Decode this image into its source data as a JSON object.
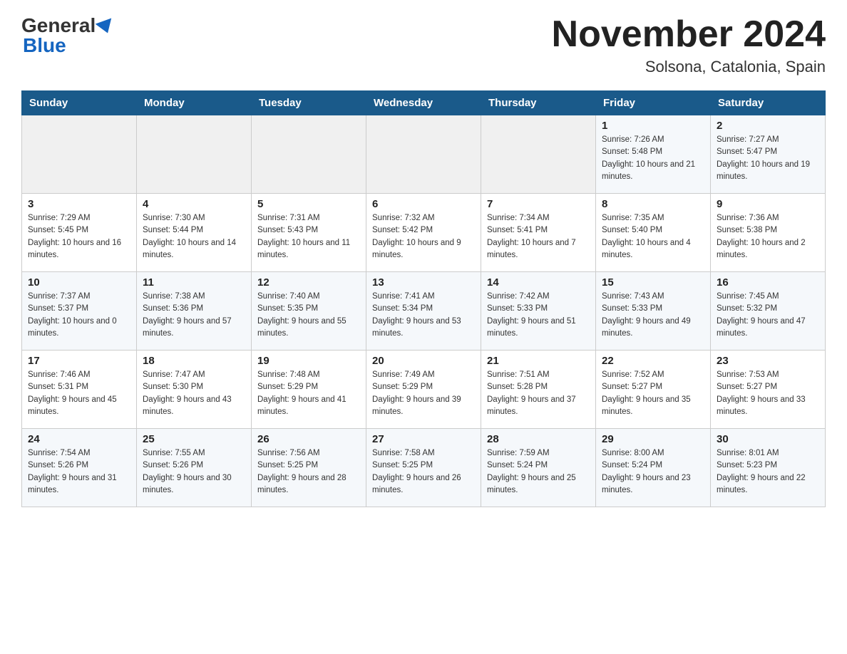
{
  "header": {
    "logo_general": "General",
    "logo_blue": "Blue",
    "title": "November 2024",
    "subtitle": "Solsona, Catalonia, Spain"
  },
  "calendar": {
    "weekdays": [
      "Sunday",
      "Monday",
      "Tuesday",
      "Wednesday",
      "Thursday",
      "Friday",
      "Saturday"
    ],
    "weeks": [
      [
        {
          "day": "",
          "info": ""
        },
        {
          "day": "",
          "info": ""
        },
        {
          "day": "",
          "info": ""
        },
        {
          "day": "",
          "info": ""
        },
        {
          "day": "",
          "info": ""
        },
        {
          "day": "1",
          "info": "Sunrise: 7:26 AM\nSunset: 5:48 PM\nDaylight: 10 hours and 21 minutes."
        },
        {
          "day": "2",
          "info": "Sunrise: 7:27 AM\nSunset: 5:47 PM\nDaylight: 10 hours and 19 minutes."
        }
      ],
      [
        {
          "day": "3",
          "info": "Sunrise: 7:29 AM\nSunset: 5:45 PM\nDaylight: 10 hours and 16 minutes."
        },
        {
          "day": "4",
          "info": "Sunrise: 7:30 AM\nSunset: 5:44 PM\nDaylight: 10 hours and 14 minutes."
        },
        {
          "day": "5",
          "info": "Sunrise: 7:31 AM\nSunset: 5:43 PM\nDaylight: 10 hours and 11 minutes."
        },
        {
          "day": "6",
          "info": "Sunrise: 7:32 AM\nSunset: 5:42 PM\nDaylight: 10 hours and 9 minutes."
        },
        {
          "day": "7",
          "info": "Sunrise: 7:34 AM\nSunset: 5:41 PM\nDaylight: 10 hours and 7 minutes."
        },
        {
          "day": "8",
          "info": "Sunrise: 7:35 AM\nSunset: 5:40 PM\nDaylight: 10 hours and 4 minutes."
        },
        {
          "day": "9",
          "info": "Sunrise: 7:36 AM\nSunset: 5:38 PM\nDaylight: 10 hours and 2 minutes."
        }
      ],
      [
        {
          "day": "10",
          "info": "Sunrise: 7:37 AM\nSunset: 5:37 PM\nDaylight: 10 hours and 0 minutes."
        },
        {
          "day": "11",
          "info": "Sunrise: 7:38 AM\nSunset: 5:36 PM\nDaylight: 9 hours and 57 minutes."
        },
        {
          "day": "12",
          "info": "Sunrise: 7:40 AM\nSunset: 5:35 PM\nDaylight: 9 hours and 55 minutes."
        },
        {
          "day": "13",
          "info": "Sunrise: 7:41 AM\nSunset: 5:34 PM\nDaylight: 9 hours and 53 minutes."
        },
        {
          "day": "14",
          "info": "Sunrise: 7:42 AM\nSunset: 5:33 PM\nDaylight: 9 hours and 51 minutes."
        },
        {
          "day": "15",
          "info": "Sunrise: 7:43 AM\nSunset: 5:33 PM\nDaylight: 9 hours and 49 minutes."
        },
        {
          "day": "16",
          "info": "Sunrise: 7:45 AM\nSunset: 5:32 PM\nDaylight: 9 hours and 47 minutes."
        }
      ],
      [
        {
          "day": "17",
          "info": "Sunrise: 7:46 AM\nSunset: 5:31 PM\nDaylight: 9 hours and 45 minutes."
        },
        {
          "day": "18",
          "info": "Sunrise: 7:47 AM\nSunset: 5:30 PM\nDaylight: 9 hours and 43 minutes."
        },
        {
          "day": "19",
          "info": "Sunrise: 7:48 AM\nSunset: 5:29 PM\nDaylight: 9 hours and 41 minutes."
        },
        {
          "day": "20",
          "info": "Sunrise: 7:49 AM\nSunset: 5:29 PM\nDaylight: 9 hours and 39 minutes."
        },
        {
          "day": "21",
          "info": "Sunrise: 7:51 AM\nSunset: 5:28 PM\nDaylight: 9 hours and 37 minutes."
        },
        {
          "day": "22",
          "info": "Sunrise: 7:52 AM\nSunset: 5:27 PM\nDaylight: 9 hours and 35 minutes."
        },
        {
          "day": "23",
          "info": "Sunrise: 7:53 AM\nSunset: 5:27 PM\nDaylight: 9 hours and 33 minutes."
        }
      ],
      [
        {
          "day": "24",
          "info": "Sunrise: 7:54 AM\nSunset: 5:26 PM\nDaylight: 9 hours and 31 minutes."
        },
        {
          "day": "25",
          "info": "Sunrise: 7:55 AM\nSunset: 5:26 PM\nDaylight: 9 hours and 30 minutes."
        },
        {
          "day": "26",
          "info": "Sunrise: 7:56 AM\nSunset: 5:25 PM\nDaylight: 9 hours and 28 minutes."
        },
        {
          "day": "27",
          "info": "Sunrise: 7:58 AM\nSunset: 5:25 PM\nDaylight: 9 hours and 26 minutes."
        },
        {
          "day": "28",
          "info": "Sunrise: 7:59 AM\nSunset: 5:24 PM\nDaylight: 9 hours and 25 minutes."
        },
        {
          "day": "29",
          "info": "Sunrise: 8:00 AM\nSunset: 5:24 PM\nDaylight: 9 hours and 23 minutes."
        },
        {
          "day": "30",
          "info": "Sunrise: 8:01 AM\nSunset: 5:23 PM\nDaylight: 9 hours and 22 minutes."
        }
      ]
    ]
  }
}
